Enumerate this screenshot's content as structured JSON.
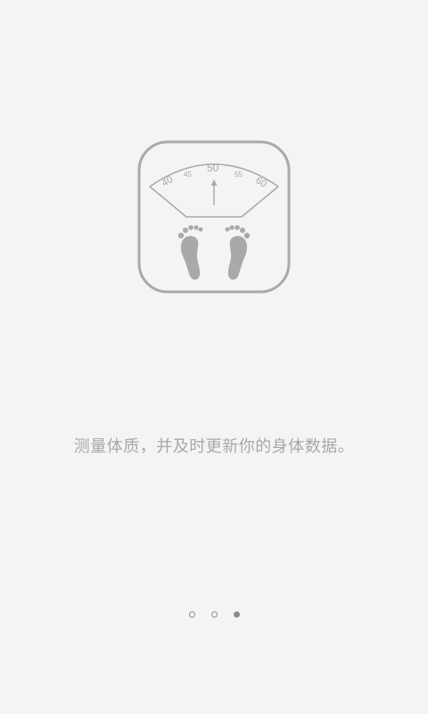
{
  "onboarding": {
    "icon": "bathroom-scale-icon",
    "scale_dial": {
      "tick_labels": [
        "40",
        "45",
        "50",
        "55",
        "60"
      ]
    },
    "caption": "测量体质，并及时更新你的身体数据。",
    "pager": {
      "count": 3,
      "active_index": 2
    },
    "colors": {
      "background": "#f4f4f4",
      "icon_stroke": "#a9a9a9",
      "caption_text": "#a8a8a8",
      "dot": "#8c8c8c"
    }
  }
}
